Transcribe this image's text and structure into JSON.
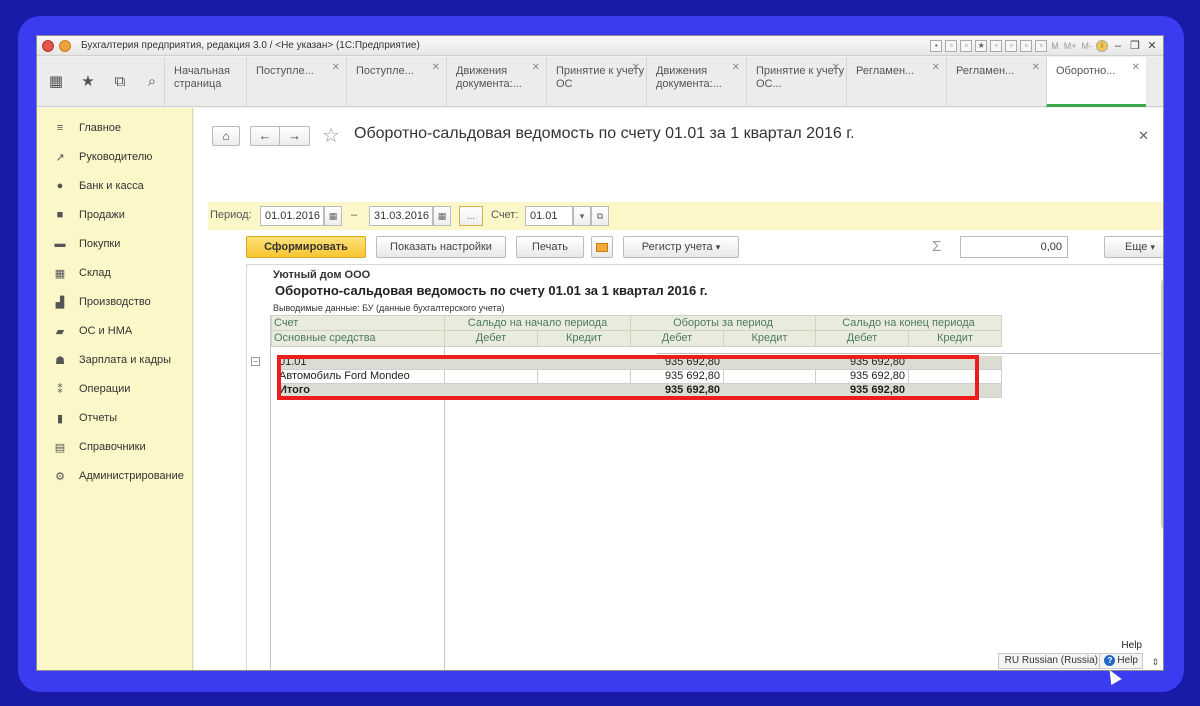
{
  "window": {
    "title": "Бухгалтерия предприятия, редакция 3.0 / <Не указан>  (1С:Предприятие)",
    "tb_m": "M",
    "tb_mplus": "M+",
    "tb_mminus": "M-"
  },
  "tabs": [
    {
      "label": "Начальная страница"
    },
    {
      "label": "Поступле..."
    },
    {
      "label": "Поступле..."
    },
    {
      "label": "Движения документа:..."
    },
    {
      "label": "Принятие к учету ОС"
    },
    {
      "label": "Движения документа:..."
    },
    {
      "label": "Принятие к учету ОС..."
    },
    {
      "label": "Регламен..."
    },
    {
      "label": "Регламен..."
    },
    {
      "label": "Оборотно..."
    }
  ],
  "sidebar": {
    "items": [
      {
        "label": "Главное",
        "icon": "menu-icon"
      },
      {
        "label": "Руководителю",
        "icon": "chart-line-icon"
      },
      {
        "label": "Банк и касса",
        "icon": "ruble-icon"
      },
      {
        "label": "Продажи",
        "icon": "bag-icon"
      },
      {
        "label": "Покупки",
        "icon": "cart-icon"
      },
      {
        "label": "Склад",
        "icon": "warehouse-icon"
      },
      {
        "label": "Производство",
        "icon": "factory-icon"
      },
      {
        "label": "ОС и НМА",
        "icon": "truck-icon"
      },
      {
        "label": "Зарплата и кадры",
        "icon": "people-icon"
      },
      {
        "label": "Операции",
        "icon": "operations-icon"
      },
      {
        "label": "Отчеты",
        "icon": "bar-chart-icon"
      },
      {
        "label": "Справочники",
        "icon": "book-icon"
      },
      {
        "label": "Администрирование",
        "icon": "gear-icon"
      }
    ]
  },
  "main": {
    "title": "Оборотно-сальдовая ведомость по счету 01.01 за 1 квартал 2016 г.",
    "period_label": "Период:",
    "date_from": "01.01.2016",
    "dash": "–",
    "date_to": "31.03.2016",
    "dots": "...",
    "account_label": "Счет:",
    "account_value": "01.01",
    "buttons": {
      "generate": "Сформировать",
      "show_settings": "Показать настройки",
      "print": "Печать",
      "register": "Регистр учета",
      "more": "Еще"
    },
    "sum_value": "0,00"
  },
  "report": {
    "org": "Уютный дом ООО",
    "title": "Оборотно-сальдовая ведомость по счету 01.01 за 1 квартал 2016 г.",
    "subtitle": "Выводимые данные:  БУ (данные бухгалтерского учета)",
    "headers": {
      "account": "Счет",
      "fixed_assets": "Основные средства",
      "opening": "Сальдо на начало периода",
      "turnover": "Обороты за период",
      "closing": "Сальдо на конец периода",
      "debit": "Дебет",
      "credit": "Кредит"
    },
    "rows": [
      {
        "name": "01.01",
        "open_d": "",
        "open_c": "",
        "turn_d": "935 692,80",
        "turn_c": "",
        "close_d": "935 692,80",
        "close_c": ""
      },
      {
        "name": "Автомобиль Ford Mondeo",
        "open_d": "",
        "open_c": "",
        "turn_d": "935 692,80",
        "turn_c": "",
        "close_d": "935 692,80",
        "close_c": ""
      },
      {
        "name": "Итого",
        "open_d": "",
        "open_c": "",
        "turn_d": "935 692,80",
        "turn_c": "",
        "close_d": "935 692,80",
        "close_c": ""
      }
    ]
  },
  "status": {
    "lang": "RU Russian (Russia)",
    "help": "Help",
    "help_tip": "Help"
  }
}
